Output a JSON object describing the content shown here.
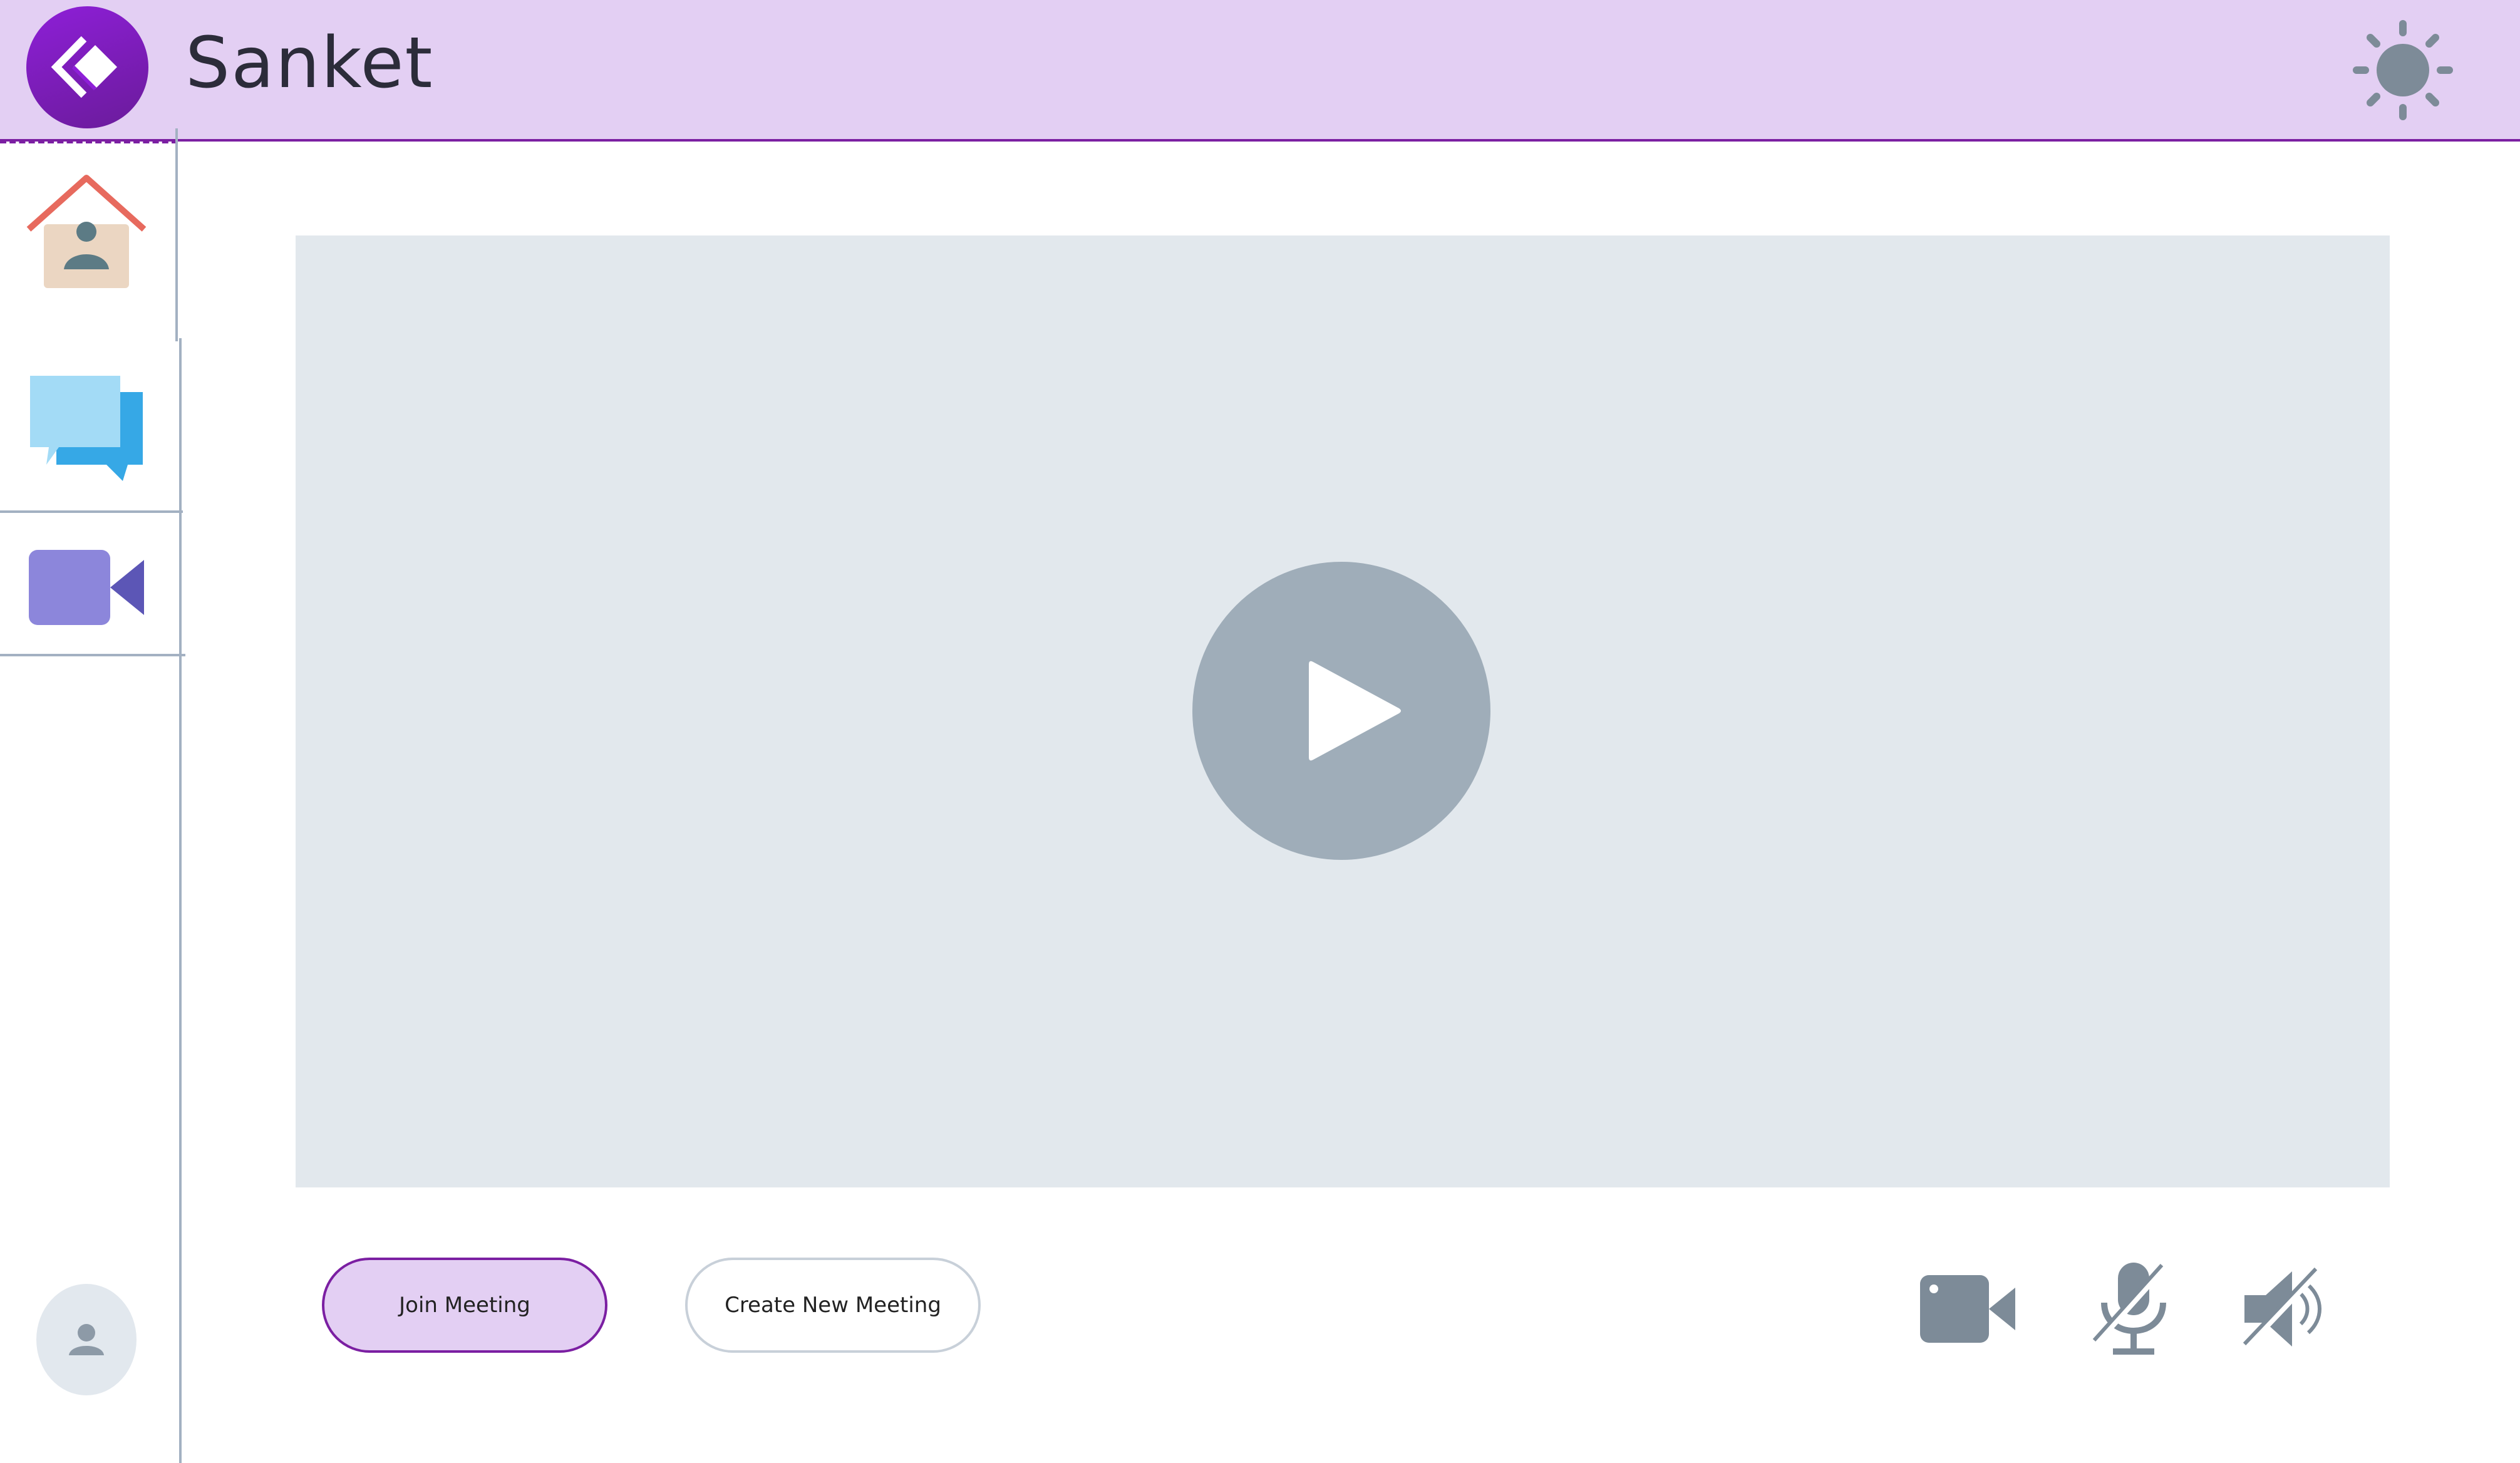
{
  "app": {
    "title": "Sanket",
    "logo_icon": "diamond-chevron-logo",
    "theme_toggle_icon": "sun-icon"
  },
  "sidebar": {
    "items": [
      {
        "id": "home",
        "icon": "home-user-icon"
      },
      {
        "id": "chat",
        "icon": "chat-bubbles-icon"
      },
      {
        "id": "video",
        "icon": "video-camera-icon"
      }
    ],
    "profile_icon": "user-avatar-icon"
  },
  "main": {
    "video_preview_icon": "play-icon",
    "join_label": "Join Meeting",
    "create_label": "Create New Meeting"
  },
  "controls": {
    "camera_icon": "camera-icon",
    "mic_icon": "mic-muted-icon",
    "speaker_icon": "speaker-muted-icon"
  },
  "colors": {
    "accent": "#7b1fa2",
    "header_bg": "#e3cff3",
    "icon_gray": "#7d8b98",
    "video_bg": "#e2e8ed"
  }
}
